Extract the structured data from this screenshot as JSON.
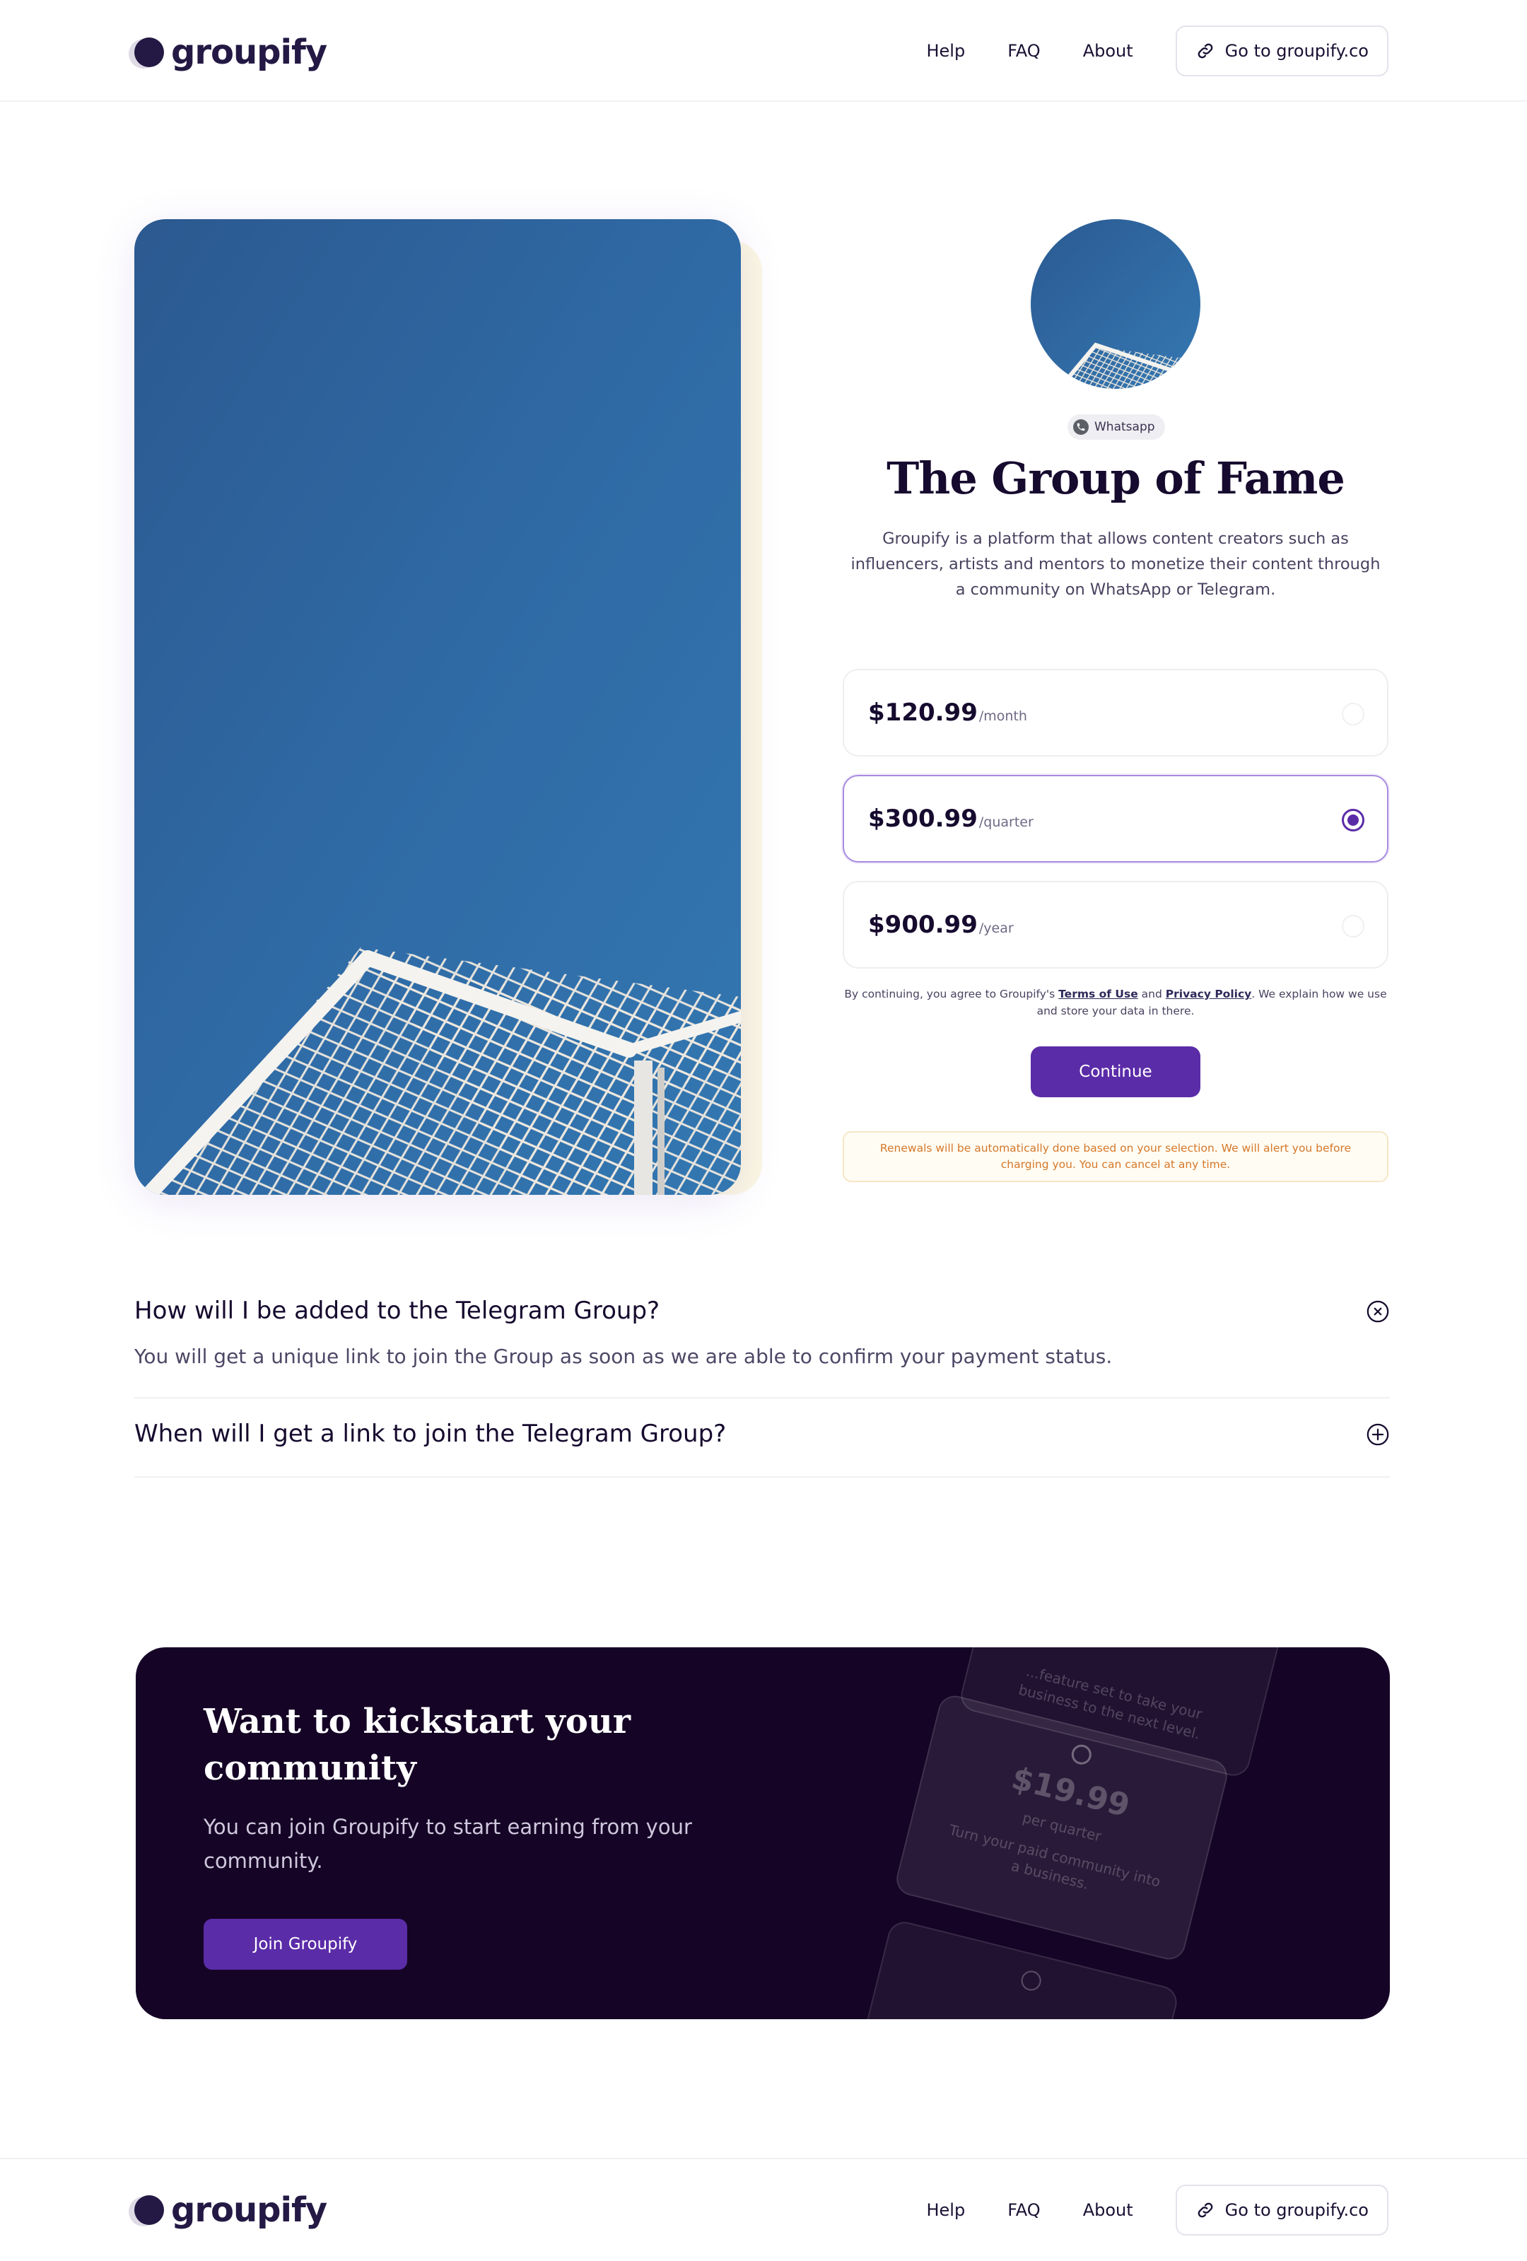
{
  "brand": {
    "name": "groupify"
  },
  "nav": {
    "links": [
      "Help",
      "FAQ",
      "About"
    ],
    "cta": "Go to groupify.co"
  },
  "group": {
    "platform": "Whatsapp",
    "title": "The Group of Fame",
    "description": "Groupify is a platform that allows content creators such as influencers, artists and mentors to monetize their content through a community on WhatsApp or Telegram."
  },
  "plans": [
    {
      "price": "$120.99",
      "period": "/month",
      "selected": false
    },
    {
      "price": "$300.99",
      "period": "/quarter",
      "selected": true
    },
    {
      "price": "$900.99",
      "period": "/year",
      "selected": false
    }
  ],
  "terms": {
    "before": "By continuing, you agree to Groupify's ",
    "terms_link": "Terms of Use",
    "and": " and ",
    "privacy_link": "Privacy Policy",
    "after": ". We explain how we use and store your data in there."
  },
  "continue_label": "Continue",
  "renewal_note": "Renewals will be automatically done based on your selection. We will alert you before charging you. You can cancel at any time.",
  "faq": [
    {
      "question": "How will I be added to the Telegram Group?",
      "answer": "You will get a unique link to join the Group as soon as we are able to confirm your payment status.",
      "open": true
    },
    {
      "question": "When will I get a link to join the Telegram Group?",
      "answer": "",
      "open": false
    }
  ],
  "cta": {
    "title": "Want to kickstart your community",
    "description": "You can join Groupify to start earning from your community.",
    "button": "Join Groupify",
    "card_top_text": "...feature set to take your business to the next level.",
    "card_price": "$19.99",
    "card_period": "per quarter",
    "card_desc": "Turn your paid community into a business."
  },
  "colors": {
    "accent": "#5b2ca8",
    "dark_band": "#150426",
    "title": "#160a2e",
    "warning_text": "#d5782a",
    "warning_bg": "#fffcf3",
    "sky": "#2f6aa3"
  }
}
